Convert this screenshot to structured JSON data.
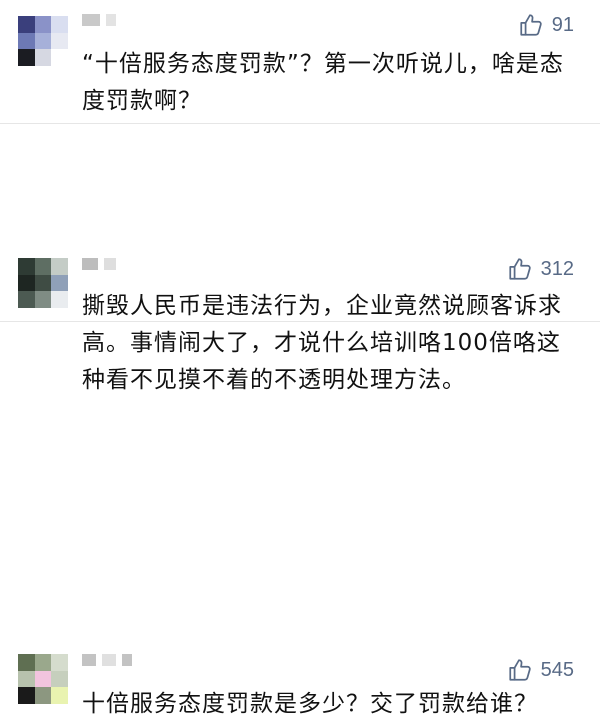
{
  "comments": [
    {
      "likes": "91",
      "text": "“十倍服务态度罚款”？第一次听说儿，啥是态度罚款啊？",
      "avatar_colors": [
        "#3a3f7c",
        "#8a92c8",
        "#d9def0",
        "#6d79b5",
        "#a6b0d9",
        "#e7e9f2",
        "#1b1c22",
        "#d6d8e2",
        "#ffffff"
      ],
      "name_colors": [
        "#c9c9c9",
        "#e3e3e3"
      ]
    },
    {
      "likes": "312",
      "text": "撕毁人民币是违法行为，企业竟然说顾客诉求高。事情闹大了，才说什么培训咯100倍咯这种看不见摸不着的不透明处理方法。",
      "avatar_colors": [
        "#2e3b34",
        "#5e6e63",
        "#c4ccc6",
        "#1e2622",
        "#3f4c44",
        "#8fa0b8",
        "#4c5a52",
        "#7f8c84",
        "#e9ecef"
      ],
      "name_colors": [
        "#bdbdbd",
        "#dedede"
      ]
    },
    {
      "likes": "545",
      "text": "十倍服务态度罚款是多少？交了罚款给谁？",
      "avatar_colors": [
        "#5f6f52",
        "#9aa88c",
        "#d5dccd",
        "#b7c2ad",
        "#f2c4de",
        "#c6cfbd",
        "#1a1a1a",
        "#8c9780",
        "#e9f3b0"
      ],
      "name_colors": [
        "#c3c3c3",
        "#e0e0e0"
      ]
    }
  ],
  "icons": {
    "like": "thumbs-up-icon"
  },
  "colors": {
    "like_text": "#586a86",
    "divider": "#e6e6e6"
  }
}
